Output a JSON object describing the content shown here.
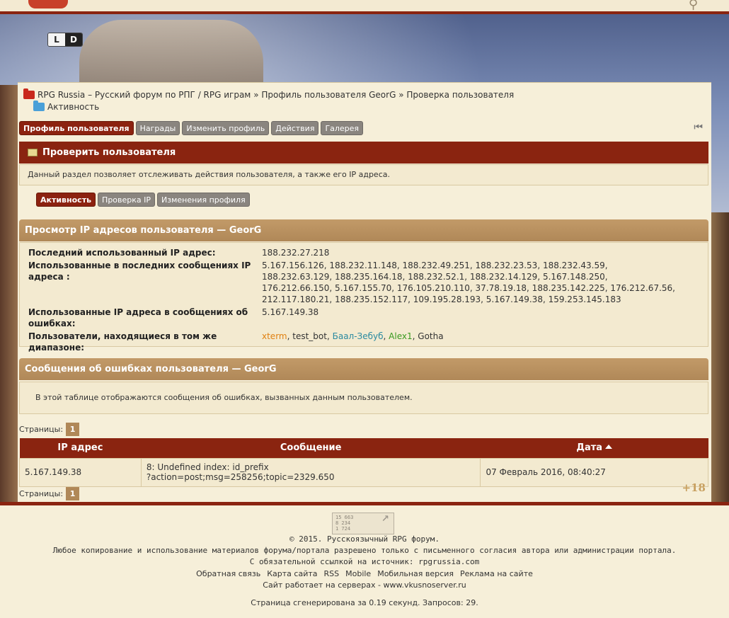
{
  "theme_switch": {
    "light": "L",
    "dark": "D"
  },
  "breadcrumb": {
    "forum": "RPG Russia – Русский форум по РПГ / RPG играм",
    "sep1": "»",
    "profile": "Профиль пользователя GeorG",
    "sep2": "»",
    "check": "Проверка пользователя",
    "current": "Активность"
  },
  "tabs": [
    {
      "label": "Профиль пользователя",
      "active": true
    },
    {
      "label": "Награды"
    },
    {
      "label": "Изменить профиль"
    },
    {
      "label": "Действия"
    },
    {
      "label": "Галерея"
    }
  ],
  "collapse_glyph": "⏮",
  "check_section": {
    "title": "Проверить пользователя",
    "description": "Данный раздел позволяет отслеживать действия пользователя, а также его IP адреса."
  },
  "subtabs": [
    {
      "label": "Активность",
      "active": true
    },
    {
      "label": "Проверка IP"
    },
    {
      "label": "Изменения профиля"
    }
  ],
  "ip_section": {
    "title": "Просмотр IP адресов пользователя — GeorG",
    "last_ip_label": "Последний использованный IP адрес:",
    "last_ip": "188.232.27.218",
    "recent_label": "Использованные в последних сообщениях IP адреса :",
    "recent_ips": "5.167.156.126, 188.232.11.148, 188.232.49.251, 188.232.23.53, 188.232.43.59, 188.232.63.129, 188.235.164.18, 188.232.52.1, 188.232.14.129, 5.167.148.250, 176.212.66.150, 5.167.155.70, 176.105.210.110, 37.78.19.18, 188.235.142.225, 176.212.67.56, 212.117.180.21, 188.235.152.117, 109.195.28.193, 5.167.149.38, 159.253.145.183",
    "errors_label": "Использованные IP адреса в сообщениях об ошибках:",
    "errors_ip": "5.167.149.38",
    "same_range_label": "Пользователи, находящиеся в том же диапазоне:",
    "same_range_users": [
      {
        "name": "xterm",
        "color": "#e08010"
      },
      {
        "name": "test_bot",
        "color": "#333333"
      },
      {
        "name": "Баал-Зебуб",
        "color": "#2a8aa0"
      },
      {
        "name": "Alex1",
        "color": "#3a9a20"
      },
      {
        "name": "Gotha",
        "color": "#333333"
      }
    ]
  },
  "errors_section": {
    "title": "Сообщения об ошибках пользователя — GeorG",
    "description": "В этой таблице отображаются сообщения об ошибках, вызванных данным пользователем.",
    "pages_label": "Страницы:",
    "page": "1",
    "columns": {
      "ip": "IP адрес",
      "message": "Сообщение",
      "date": "Дата"
    },
    "rows": [
      {
        "ip": "5.167.149.38",
        "message_line1": "8: Undefined index: id_prefix",
        "message_line2": "?action=post;msg=258256;topic=2329.650",
        "date": "07 Февраль 2016, 08:40:27"
      }
    ]
  },
  "age_badge": "+18",
  "footer": {
    "counter": [
      "15 663",
      "8 234",
      "1 724"
    ],
    "copyright": "© 2015. Русскоязычный RPG форум.",
    "copy_notice": "Любое копирование и использование материалов форума/портала разрешено только с письменного согласия автора или администрации портала.",
    "source_notice": "С обязательной ссылкой на источник: rpgrussia.com",
    "links": [
      "Обратная связь",
      "Карта сайта",
      "RSS",
      "Mobile",
      "Мобильная версия",
      "Реклама на сайте"
    ],
    "servers": "Сайт работает на серверах - www.vkusnoserver.ru",
    "generated": "Страница сгенерирована за 0.19 секунд. Запросов: 29."
  }
}
